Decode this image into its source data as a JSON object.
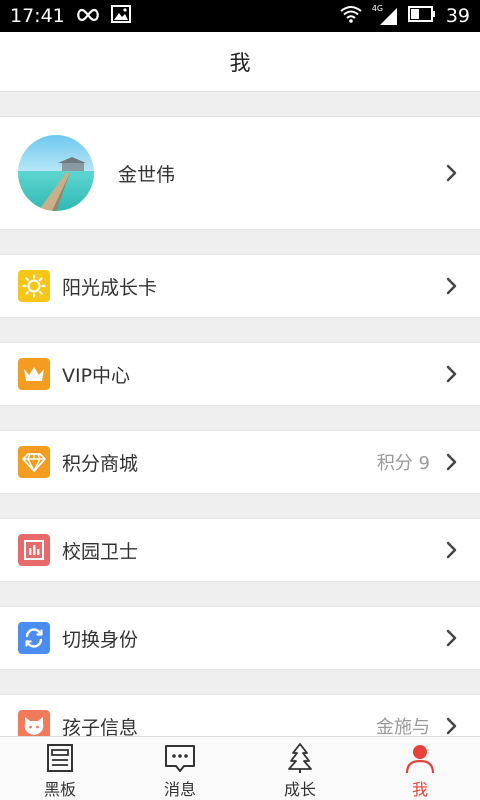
{
  "status_bar": {
    "time": "17:41",
    "signal_label": "4G",
    "battery_level": "39",
    "icons": [
      "infinity-icon",
      "image-icon",
      "wifi-icon",
      "signal-icon",
      "battery-icon"
    ]
  },
  "header": {
    "title": "我"
  },
  "profile": {
    "name": "金世伟",
    "avatar_icon": "beach-pier-avatar"
  },
  "menu": [
    {
      "label": "阳光成长卡",
      "value": "",
      "icon": "sun-card-icon",
      "icon_color": "#f5c518"
    },
    {
      "label": "VIP中心",
      "value": "",
      "icon": "crown-icon",
      "icon_color": "#f39c1f"
    },
    {
      "label": "积分商城",
      "value": "积分 9",
      "icon": "diamond-icon",
      "icon_color": "#f39c1f"
    },
    {
      "label": "校园卫士",
      "value": "",
      "icon": "chart-shield-icon",
      "icon_color": "#e86a6a"
    },
    {
      "label": "切换身份",
      "value": "",
      "icon": "switch-icon",
      "icon_color": "#4a8cf0"
    },
    {
      "label": "孩子信息",
      "value": "金施与",
      "icon": "child-face-icon",
      "icon_color": "#f07a5a"
    }
  ],
  "bottom_nav": [
    {
      "label": "黑板",
      "icon": "blackboard-icon",
      "active": false
    },
    {
      "label": "消息",
      "icon": "message-icon",
      "active": false
    },
    {
      "label": "成长",
      "icon": "tree-icon",
      "active": false
    },
    {
      "label": "我",
      "icon": "person-icon",
      "active": true
    }
  ],
  "colors": {
    "accent": "#e8433a",
    "background": "#efefef",
    "text_secondary": "#9a9a9a"
  }
}
